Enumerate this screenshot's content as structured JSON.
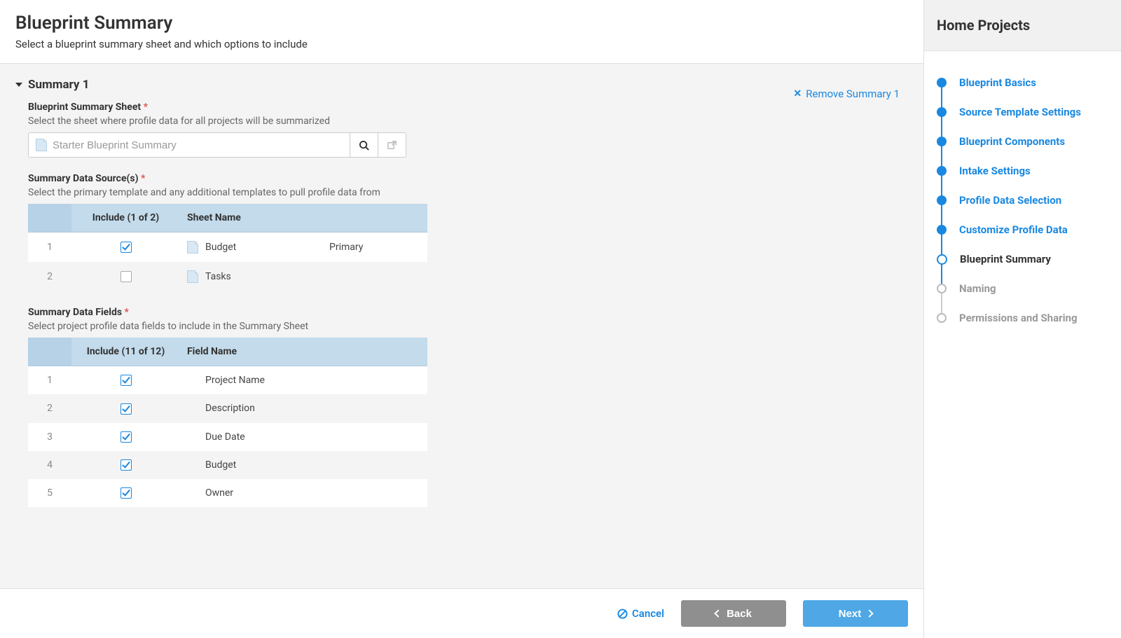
{
  "header": {
    "title": "Blueprint Summary",
    "subtitle": "Select a blueprint summary sheet and which options to include"
  },
  "summary": {
    "section_title": "Summary 1",
    "remove_label": "Remove Summary 1",
    "sheet_field": {
      "label": "Blueprint Summary Sheet",
      "help": "Select the sheet where profile data for all projects will be summarized",
      "placeholder": "Starter Blueprint Summary"
    },
    "sources_field": {
      "label": "Summary Data Source(s)",
      "help": "Select the primary template and any additional templates to pull profile data from",
      "include_header": "Include (1 of 2)",
      "name_header": "Sheet Name",
      "rows": [
        {
          "num": "1",
          "checked": true,
          "name": "Budget",
          "tag": "Primary"
        },
        {
          "num": "2",
          "checked": false,
          "name": "Tasks",
          "tag": ""
        }
      ]
    },
    "fields_field": {
      "label": "Summary Data Fields",
      "help": "Select project profile data fields to include in the Summary Sheet",
      "include_header": "Include (11 of 12)",
      "name_header": "Field Name",
      "rows": [
        {
          "num": "1",
          "checked": true,
          "name": "Project Name"
        },
        {
          "num": "2",
          "checked": true,
          "name": "Description"
        },
        {
          "num": "3",
          "checked": true,
          "name": "Due Date"
        },
        {
          "num": "4",
          "checked": true,
          "name": "Budget"
        },
        {
          "num": "5",
          "checked": true,
          "name": "Owner"
        }
      ]
    }
  },
  "footer": {
    "cancel": "Cancel",
    "back": "Back",
    "next": "Next"
  },
  "sidebar": {
    "title": "Home Projects",
    "steps": [
      {
        "label": "Blueprint Basics",
        "state": "done"
      },
      {
        "label": "Source Template Settings",
        "state": "done"
      },
      {
        "label": "Blueprint Components",
        "state": "done"
      },
      {
        "label": "Intake Settings",
        "state": "done"
      },
      {
        "label": "Profile Data Selection",
        "state": "done"
      },
      {
        "label": "Customize Profile Data",
        "state": "done"
      },
      {
        "label": "Blueprint Summary",
        "state": "current"
      },
      {
        "label": "Naming",
        "state": "pending"
      },
      {
        "label": "Permissions and Sharing",
        "state": "pending"
      }
    ]
  }
}
